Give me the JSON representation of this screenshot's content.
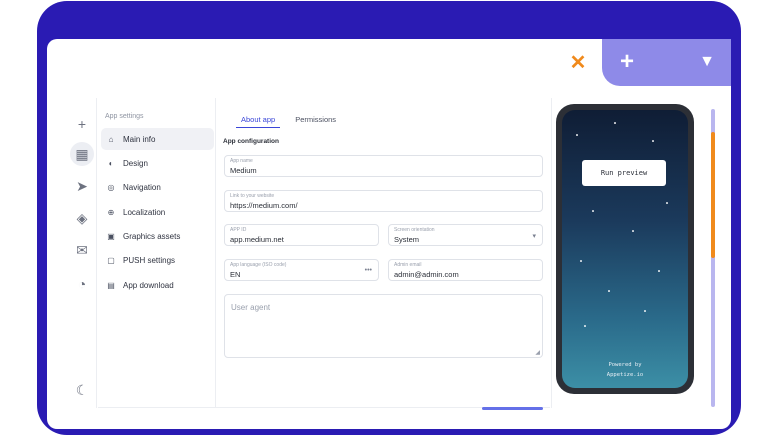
{
  "browser_tabs": {
    "close_icon": "x-icon",
    "new_tab_icon": "plus-icon",
    "menu_icon": "chevron-down-icon"
  },
  "rail": {
    "icons": [
      "plus-icon",
      "grid-icon",
      "send-icon",
      "puzzle-icon",
      "chat-icon",
      "speed-icon",
      "moon-icon"
    ]
  },
  "sidebar": {
    "heading": "App settings",
    "items": [
      {
        "label": "Main info",
        "icon": "home-icon",
        "active": true
      },
      {
        "label": "Design",
        "icon": "palette-icon",
        "active": false
      },
      {
        "label": "Navigation",
        "icon": "compass-icon",
        "active": false
      },
      {
        "label": "Localization",
        "icon": "globe-icon",
        "active": false
      },
      {
        "label": "Graphics assets",
        "icon": "image-icon",
        "active": false
      },
      {
        "label": "PUSH settings",
        "icon": "bell-icon",
        "active": false
      },
      {
        "label": "App download",
        "icon": "file-icon",
        "active": false
      }
    ]
  },
  "tabs": [
    {
      "label": "About app",
      "active": true
    },
    {
      "label": "Permissions",
      "active": false
    }
  ],
  "section_title": "App configuration",
  "fields": {
    "app_name": {
      "label": "App name",
      "value": "Medium"
    },
    "website": {
      "label": "Link to your website",
      "value": "https://medium.com/"
    },
    "app_id": {
      "label": "APP ID",
      "value": "app.medium.net"
    },
    "orientation": {
      "label": "Screen orientation",
      "value": "System"
    },
    "language": {
      "label": "App language (ISO code)",
      "value": "EN"
    },
    "admin_email": {
      "label": "Admin email",
      "value": "admin@admin.com"
    },
    "user_agent": {
      "placeholder": "User agent"
    }
  },
  "preview": {
    "run_button": "Run preview",
    "powered_by": "Powered by",
    "brand": "Appetize.io"
  },
  "colors": {
    "frame": "#2a1bb3",
    "accent": "#3a46d8",
    "orange": "#f08a1c",
    "tab_bg": "#8e8ae8"
  }
}
